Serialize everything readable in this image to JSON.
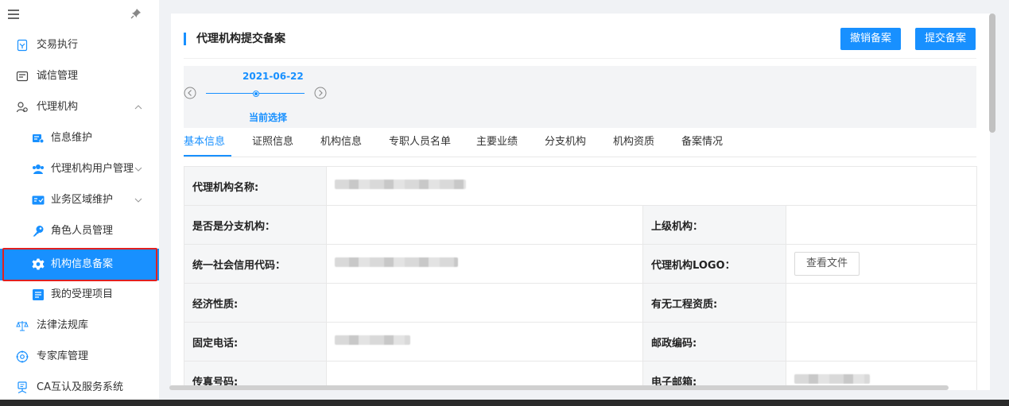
{
  "sidebar": {
    "items": [
      {
        "label": "交易执行",
        "icon": "trade-icon"
      },
      {
        "label": "诚信管理",
        "icon": "integrity-icon"
      },
      {
        "label": "代理机构",
        "icon": "agency-icon"
      },
      {
        "label": "信息维护",
        "icon": "info-edit-icon"
      },
      {
        "label": "代理机构用户管理",
        "icon": "users-icon"
      },
      {
        "label": "业务区域维护",
        "icon": "region-icon"
      },
      {
        "label": "角色人员管理",
        "icon": "key-icon"
      },
      {
        "label": "机构信息备案",
        "icon": "gear-icon"
      },
      {
        "label": "我的受理项目",
        "icon": "list-icon"
      },
      {
        "label": "法律法规库",
        "icon": "scale-icon"
      },
      {
        "label": "专家库管理",
        "icon": "expert-icon"
      },
      {
        "label": "CA互认及服务系统",
        "icon": "ca-icon"
      }
    ]
  },
  "header": {
    "title": "代理机构提交备案",
    "revoke_label": "撤销备案",
    "submit_label": "提交备案"
  },
  "timeline": {
    "date": "2021-06-22",
    "current_label": "当前选择"
  },
  "tabs": [
    "基本信息",
    "证照信息",
    "机构信息",
    "专职人员名单",
    "主要业绩",
    "分支机构",
    "机构资质",
    "备案情况"
  ],
  "fields": {
    "agency_name_label": "代理机构名称:",
    "is_branch_label": "是否是分支机构：",
    "parent_org_label": "上级机构：",
    "credit_code_label": "统一社会信用代码：",
    "logo_label": "代理机构LOGO：",
    "view_file_label": "查看文件",
    "economic_nature_label": "经济性质:",
    "qualification_label": "有无工程资质:",
    "phone_label": "固定电话:",
    "postal_label": "邮政编码:",
    "fax_label": "传真号码:",
    "email_label": "电子邮箱:"
  },
  "colors": {
    "accent": "#1890ff",
    "highlight_border": "#e02020"
  }
}
